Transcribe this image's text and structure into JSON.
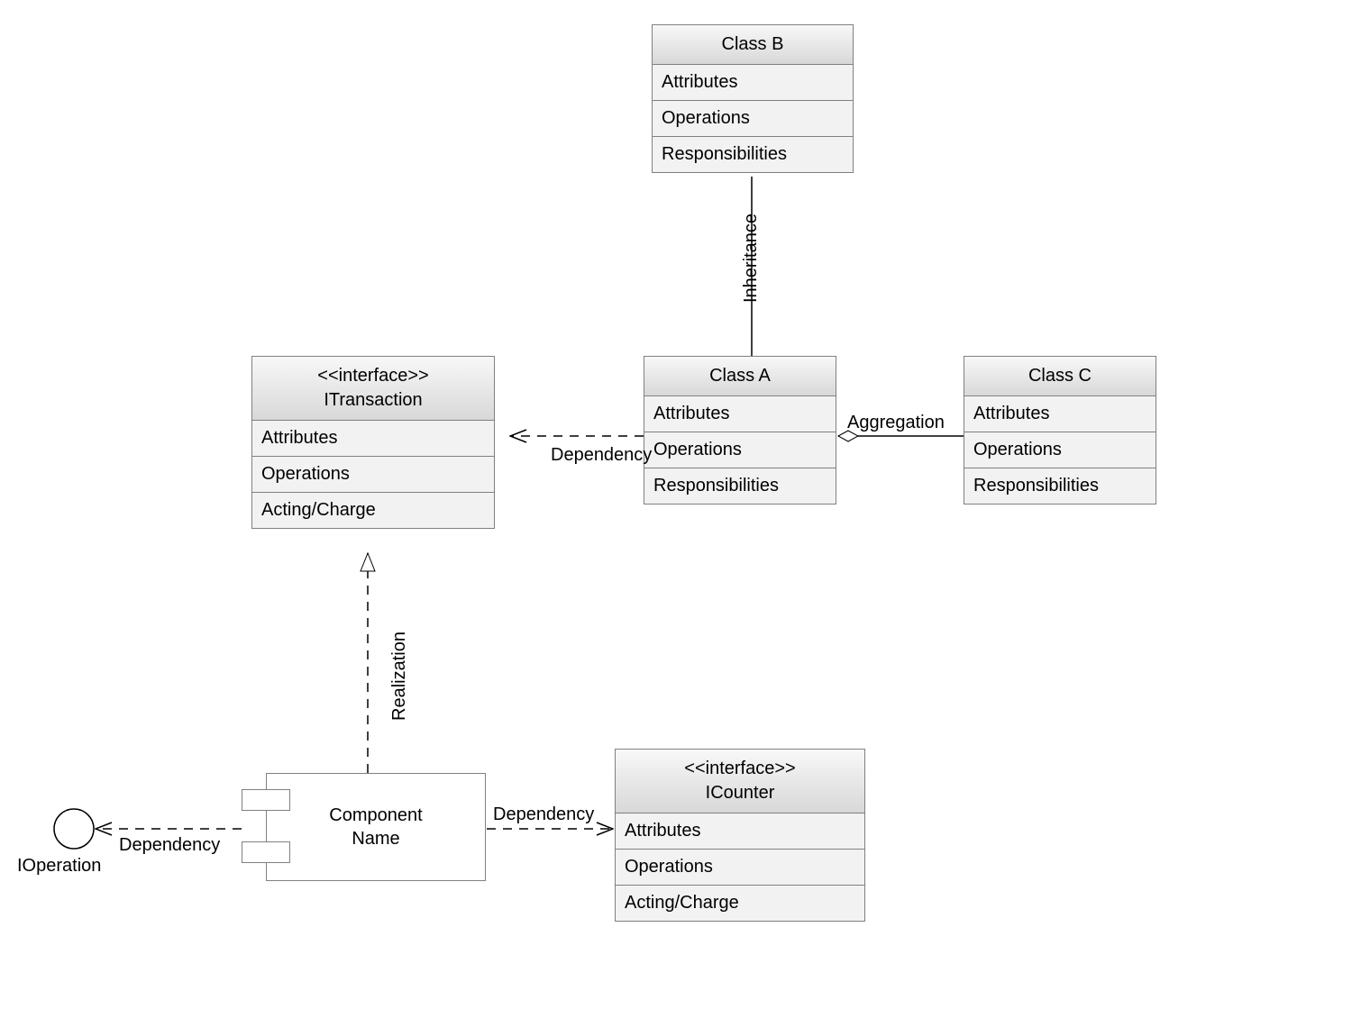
{
  "classes": {
    "classB": {
      "title": "Class B",
      "rows": [
        "Attributes",
        "Operations",
        "Responsibilities"
      ]
    },
    "classA": {
      "title": "Class A",
      "rows": [
        "Attributes",
        "Operations",
        "Responsibilities"
      ]
    },
    "classC": {
      "title": "Class C",
      "rows": [
        "Attributes",
        "Operations",
        "Responsibilities"
      ]
    },
    "itransaction": {
      "stereotype": "<<interface>>",
      "title": "ITransaction",
      "rows": [
        "Attributes",
        "Operations",
        "Acting/Charge"
      ]
    },
    "icounter": {
      "stereotype": "<<interface>>",
      "title": "ICounter",
      "rows": [
        "Attributes",
        "Operations",
        "Acting/Charge"
      ]
    }
  },
  "component": {
    "name_line1": "Component",
    "name_line2": "Name"
  },
  "lollipop": {
    "label": "IOperation"
  },
  "edge_labels": {
    "inheritance": "Inheritance",
    "dependency_a_to_itrans": "Dependency",
    "aggregation": "Aggregation",
    "realization": "Realization",
    "dependency_comp_to_iop": "Dependency",
    "dependency_comp_to_icounter": "Dependency"
  }
}
